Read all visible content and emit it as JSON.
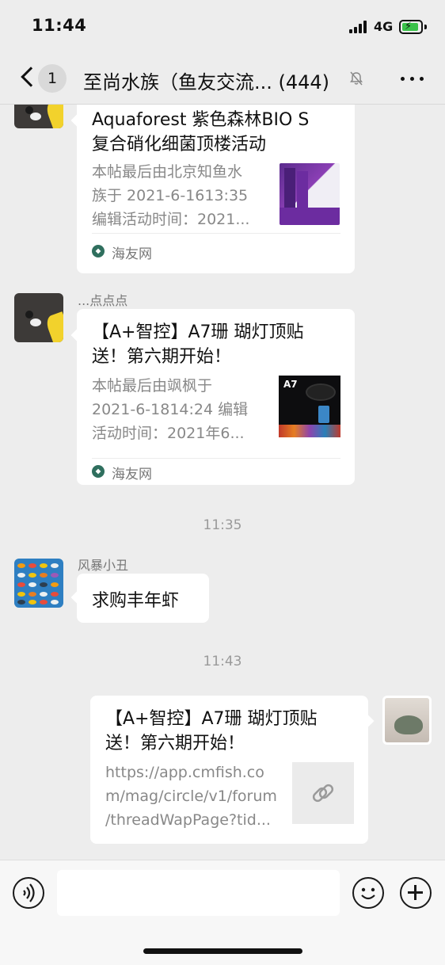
{
  "status_bar": {
    "time": "11:44",
    "network": "4G"
  },
  "nav": {
    "unread_count": "1",
    "title": "至尚水族（鱼友交流... (444)"
  },
  "messages": [
    {
      "type": "card",
      "title": "Aquaforest 紫色森林BIO S复合硝化细菌顶楼活动",
      "title_lines": [
        "Aquaforest 紫色森林BIO S",
        "复合硝化细菌顶楼活动"
      ],
      "desc_lines": [
        "本帖最后由北京知鱼水",
        "族于 2021-6-1613:35",
        "编辑活动时间：2021..."
      ],
      "source": "海友网"
    },
    {
      "type": "card",
      "sender": "...点点点",
      "title_lines": [
        "【A+智控】A7珊 瑚灯顶贴",
        "送！第六期开始！"
      ],
      "desc_lines": [
        "本帖最后由飒枫于",
        "2021-6-1814:24 编辑",
        "活动时间：2021年6..."
      ],
      "source": "海友网",
      "thumb_label": "A7"
    },
    {
      "type": "time",
      "text": "11:35"
    },
    {
      "type": "text",
      "sender": "风暴小丑",
      "text": "求购丰年虾"
    },
    {
      "type": "time",
      "text": "11:43"
    },
    {
      "type": "link",
      "title_lines": [
        "【A+智控】A7珊 瑚灯顶贴",
        "送！第六期开始！"
      ],
      "url_lines": [
        "https://app.cmfish.co",
        "m/mag/circle/v1/forum",
        "/threadWapPage?tid..."
      ]
    }
  ],
  "input": {
    "placeholder": ""
  },
  "icons": {
    "back": "chevron-left-icon",
    "mute": "bell-slash-icon",
    "more": "more-dots-icon",
    "voice": "voice-icon",
    "emoji": "smile-icon",
    "plus": "plus-icon",
    "link": "link-icon"
  }
}
